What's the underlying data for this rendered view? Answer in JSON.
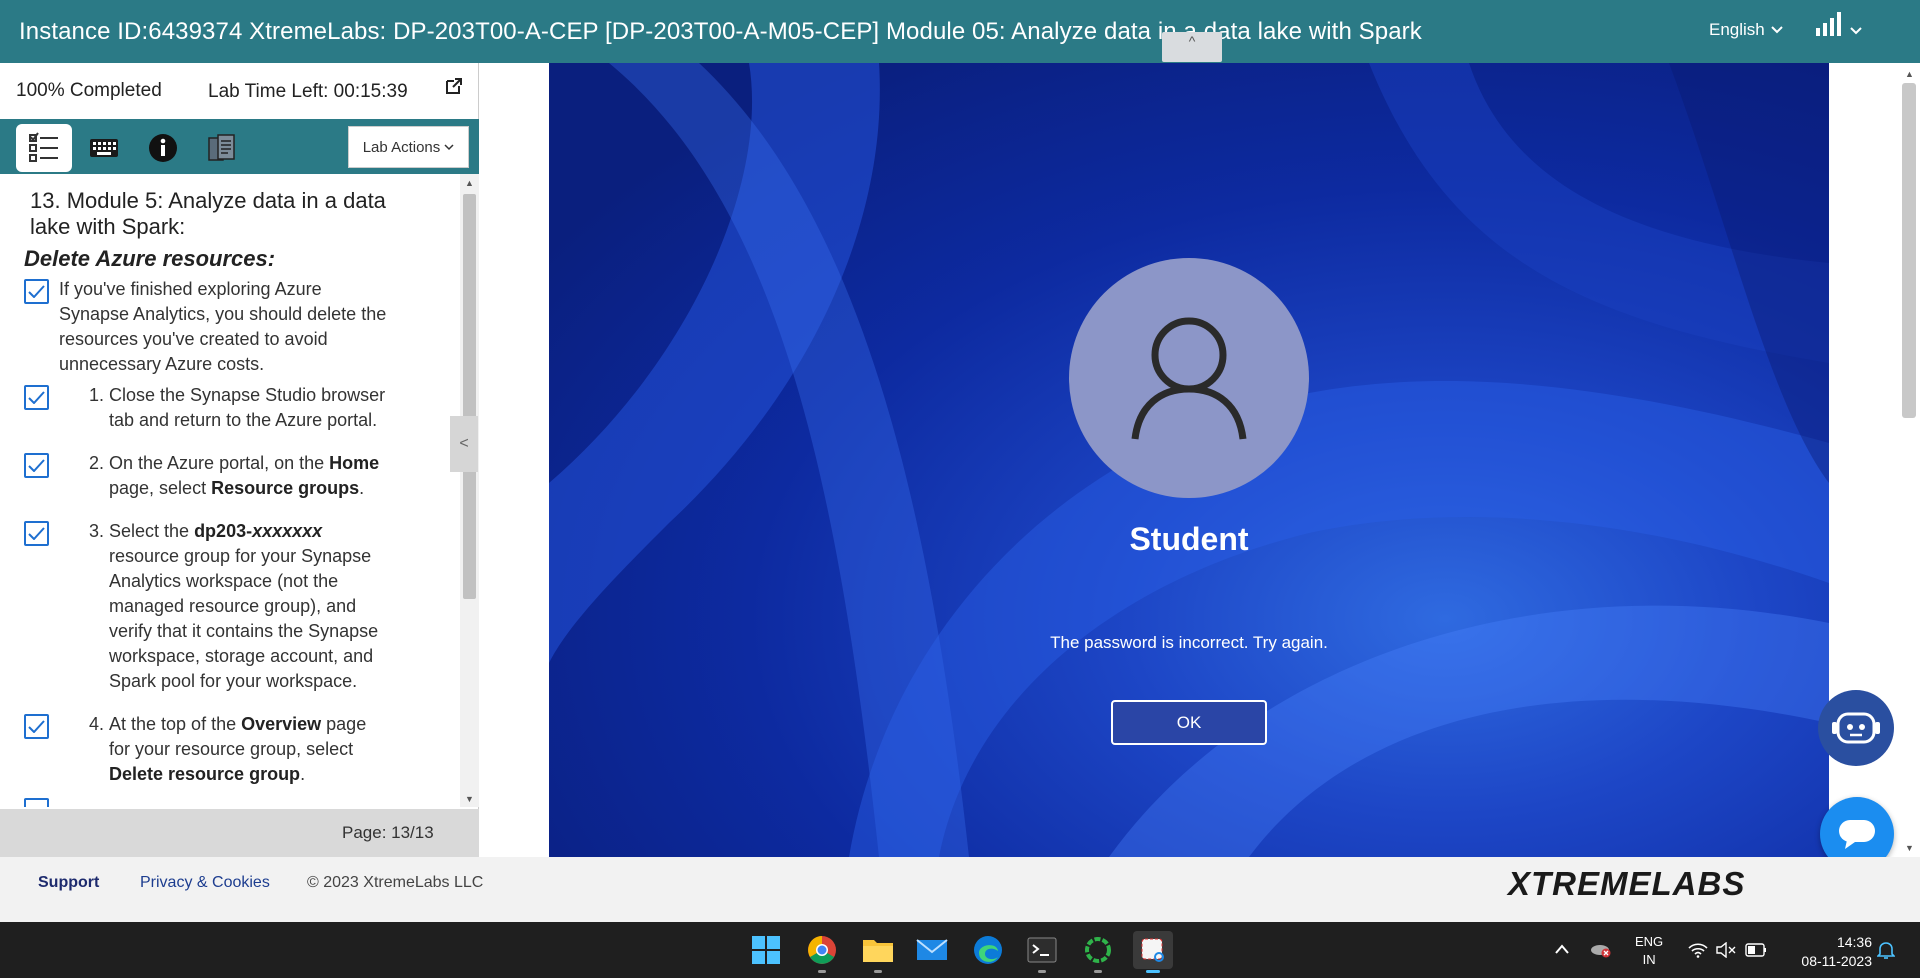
{
  "header": {
    "title": "Instance ID:6439374   XtremeLabs: DP-203T00-A-CEP [DP-203T00-A-M05-CEP] Module 05: Analyze data in a data lake with Spark",
    "language": "English",
    "collapse_glyph": "^"
  },
  "status": {
    "completed": "100% Completed",
    "time_left": "Lab Time Left: 00:15:39"
  },
  "toolbar": {
    "lab_actions": "Lab Actions"
  },
  "instructions": {
    "heading": "13. Module 5: Analyze data in a data lake with Spark:",
    "subheading": "Delete Azure resources:",
    "intro_lines": [
      "If you've finished exploring Azure",
      "Synapse Analytics, you should delete the",
      "resources you've created to avoid",
      "unnecessary Azure costs."
    ],
    "steps": [
      {
        "num": "1.",
        "lines": [
          "Close the Synapse Studio browser",
          "tab and return to the Azure portal."
        ]
      },
      {
        "num": "2.",
        "line1_pre": "On the Azure portal, on the ",
        "line1_bold": "Home",
        "line2_pre": "page, select ",
        "line2_bold": "Resource groups",
        "line2_post": "."
      },
      {
        "num": "3.",
        "line1_pre": "Select the ",
        "line1_bold": "dp203-",
        "line1_bolditalic": "xxxxxxx",
        "lines": [
          "resource group for your Synapse",
          "Analytics workspace (not the",
          "managed resource group), and",
          "verify that it contains the Synapse",
          "workspace, storage account, and",
          "Spark pool for your workspace."
        ]
      },
      {
        "num": "4.",
        "line1_pre": "At the top of the ",
        "line1_bold": "Overview",
        "line1_post": " page",
        "line2": "for your resource group, select",
        "line3_bold": "Delete resource group",
        "line3_post": "."
      }
    ],
    "page": "Page: 13/13",
    "collapse_glyph": "<"
  },
  "remote": {
    "username": "Student",
    "error": "The password is incorrect. Try again.",
    "ok": "OK"
  },
  "footer": {
    "support": "Support",
    "privacy": "Privacy & Cookies",
    "copyright": "© 2023 XtremeLabs LLC",
    "logo": "XTREMELABS"
  },
  "taskbar": {
    "lang_top": "ENG",
    "lang_bottom": "IN",
    "time": "14:36",
    "date": "08-11-2023"
  },
  "colors": {
    "header_bg": "#2b7a86",
    "checkbox": "#1e6fd0",
    "chat": "#1b8df0"
  }
}
